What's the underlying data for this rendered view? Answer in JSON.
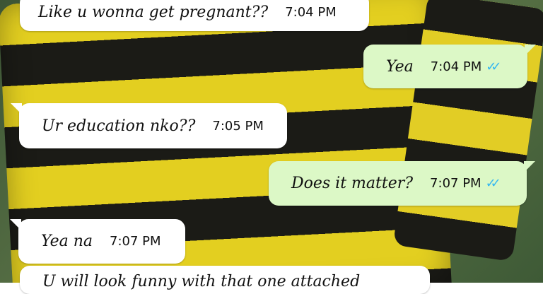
{
  "chat": {
    "messages": [
      {
        "direction": "incoming",
        "text": "Like u wonna get pregnant??",
        "time": "7:04 PM"
      },
      {
        "direction": "outgoing",
        "text": "Yea",
        "time": "7:04 PM",
        "status": "read"
      },
      {
        "direction": "incoming",
        "text": "Ur education nko??",
        "time": "7:05 PM"
      },
      {
        "direction": "outgoing",
        "text": "Does it matter?",
        "time": "7:07 PM",
        "status": "read"
      },
      {
        "direction": "incoming",
        "text": "Yea na",
        "time": "7:07 PM"
      },
      {
        "direction": "incoming",
        "text": "U will look funny with that one attached",
        "time": ""
      }
    ]
  },
  "icons": {
    "read_receipt": "double-check-icon",
    "read_receipt_glyph": "✓✓"
  },
  "colors": {
    "incoming_bubble": "#ffffff",
    "outgoing_bubble": "#dcf8c6",
    "read_tick": "#34b7f1",
    "stripe_yellow": "#e3cf20",
    "stripe_black": "#1b1b16"
  }
}
